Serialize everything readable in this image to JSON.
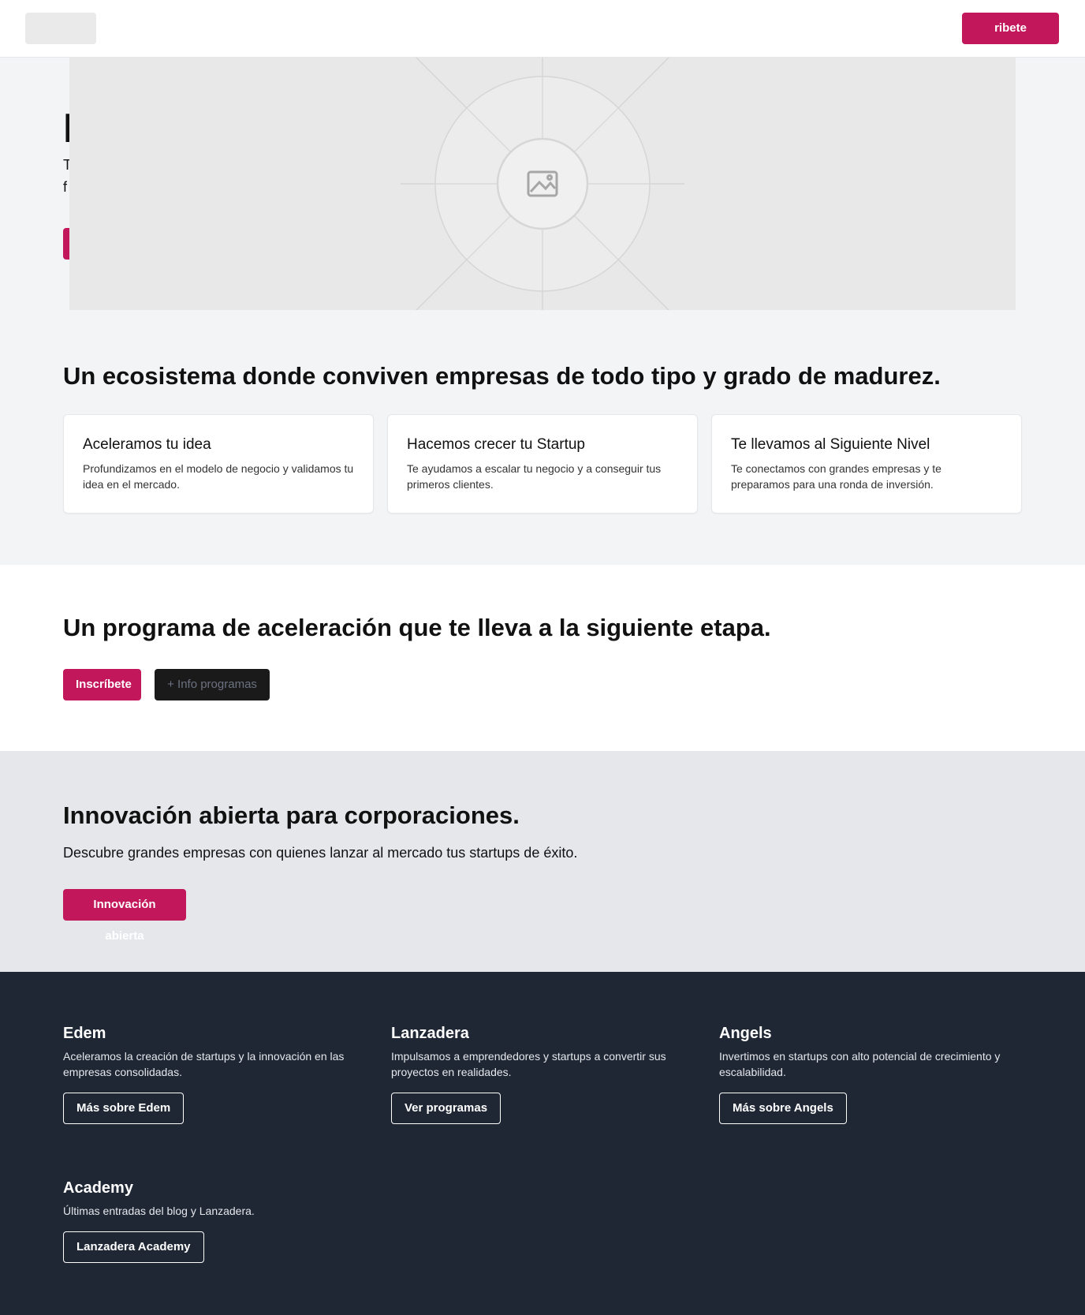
{
  "header": {
    "cta_label": "ribete"
  },
  "hero": {
    "title": "I",
    "text_line1": "T",
    "text_line2": "f",
    "image_icon": "image-icon"
  },
  "ecosystem": {
    "title": "Un ecosistema donde conviven empresas de todo tipo y grado de madurez.",
    "cards": [
      {
        "title": "Aceleramos tu idea",
        "text": "Profundizamos en el modelo de negocio y validamos tu idea en el mercado."
      },
      {
        "title": "Hacemos crecer tu Startup",
        "text": "Te ayudamos a escalar tu negocio y a conseguir tus primeros clientes."
      },
      {
        "title": "Te llevamos al Siguiente Nivel",
        "text": "Te conectamos con grandes empresas y te preparamos para una ronda de inversión."
      }
    ]
  },
  "program": {
    "title": "Un programa de aceleración que te lleva a la siguiente etapa.",
    "primary_label": "Inscríbete",
    "secondary_label": "+ Info programas"
  },
  "innovation": {
    "title": "Innovación abierta para corporaciones.",
    "text": "Descubre grandes empresas con quienes lanzar al mercado tus startups de éxito.",
    "button_label": "Innovación abierta"
  },
  "footer": {
    "columns": [
      {
        "title": "Edem",
        "text": "Aceleramos la creación de startups y la innovación en las empresas consolidadas.",
        "button": "Más sobre Edem"
      },
      {
        "title": "Lanzadera",
        "text": "Impulsamos a emprendedores y startups a convertir sus proyectos en realidades.",
        "button": "Ver programas"
      },
      {
        "title": "Angels",
        "text": "Invertimos en startups con alto potencial de crecimiento y escalabilidad.",
        "button": "Más sobre Angels"
      },
      {
        "title": "Academy",
        "text": "Últimas entradas del blog y Lanzadera.",
        "button": "Lanzadera Academy"
      }
    ]
  },
  "colors": {
    "accent": "#c2185b",
    "footer_bg": "#1f2735",
    "hero_bg": "#f3f4f6",
    "innovation_bg": "#e5e7eb"
  }
}
